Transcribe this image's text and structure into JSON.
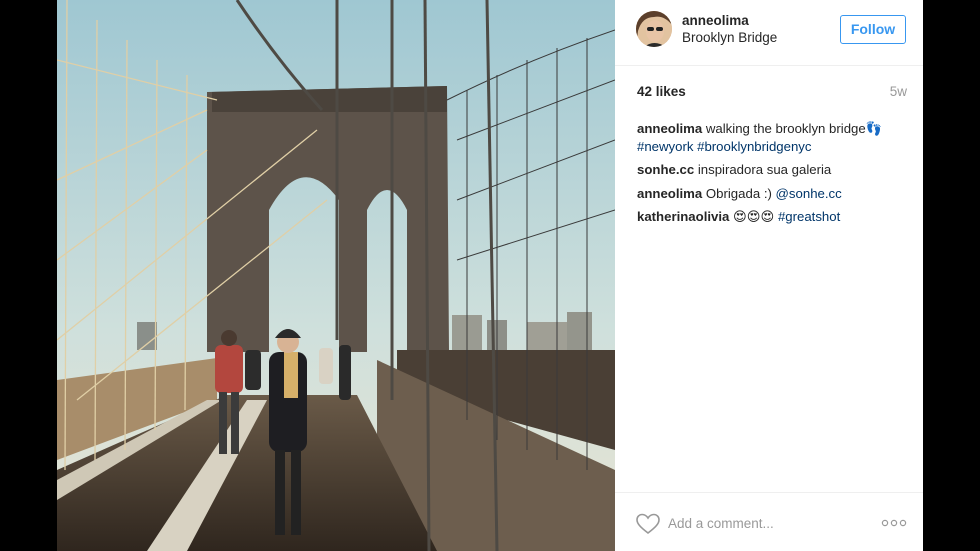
{
  "post": {
    "username": "anneolima",
    "location": "Brooklyn Bridge",
    "follow_label": "Follow",
    "likes": "42 likes",
    "time_ago": "5w"
  },
  "comments": [
    {
      "user": "anneolima",
      "text": " walking the brooklyn bridge👣 ",
      "links": [
        "#newyork",
        "#brooklynbridgenyc"
      ]
    },
    {
      "user": "sonhe.cc",
      "text": " inspiradora sua galeria",
      "links": []
    },
    {
      "user": "anneolima",
      "text": " Obrigada :) ",
      "links": [
        "@sonhe.cc"
      ]
    },
    {
      "user": "katherinaolivia",
      "text": " 😍😍😍 ",
      "links": [
        "#greatshot"
      ]
    }
  ],
  "footer": {
    "comment_placeholder": "Add a comment...",
    "like_icon": "heart-outline-icon",
    "more_icon": "more-options-icon"
  },
  "colors": {
    "link": "#003569",
    "follow_blue": "#3897f0",
    "muted": "#999999"
  }
}
